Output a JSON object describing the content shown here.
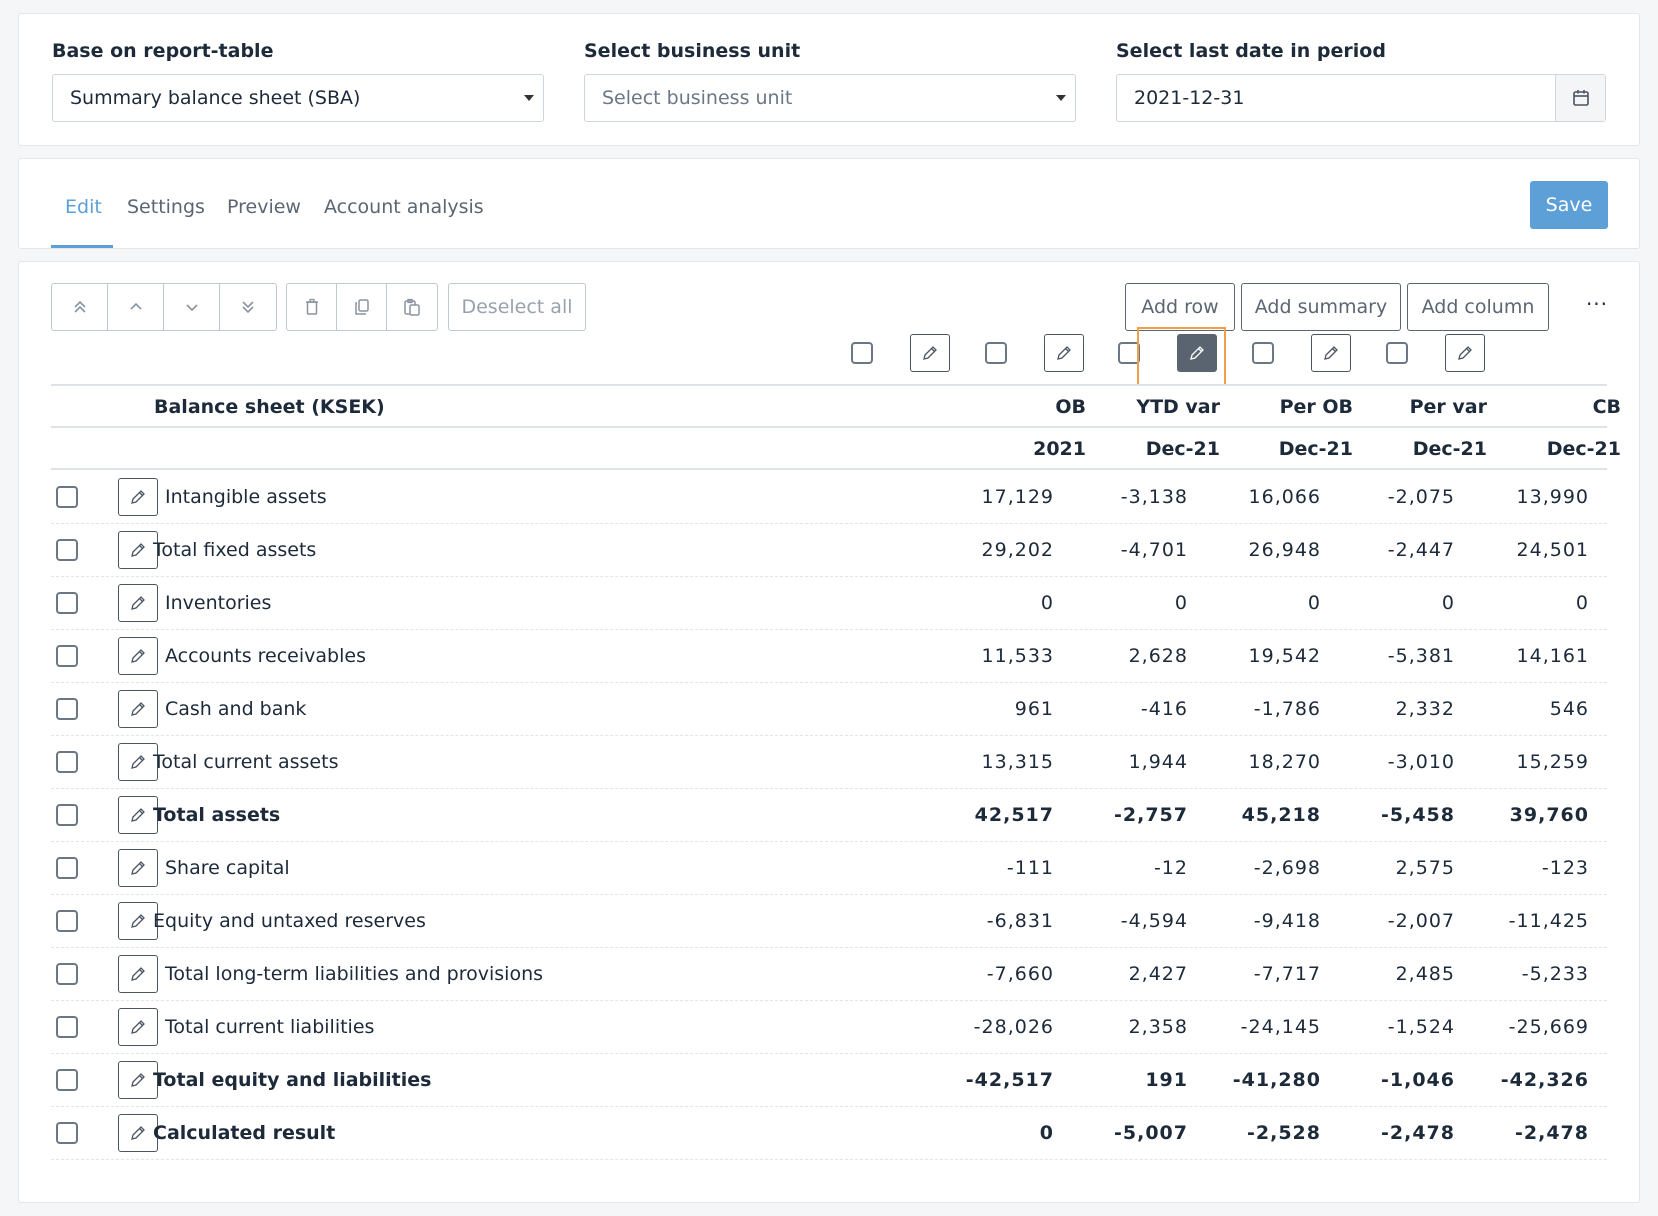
{
  "filters": {
    "report_table": {
      "label": "Base on report-table",
      "value": "Summary balance sheet (SBA)"
    },
    "business_unit": {
      "label": "Select business unit",
      "placeholder": "Select business unit"
    },
    "last_date": {
      "label": "Select last date in period",
      "value": "2021-12-31"
    }
  },
  "tabs": [
    {
      "label": "Edit",
      "active": true
    },
    {
      "label": "Settings",
      "active": false
    },
    {
      "label": "Preview",
      "active": false
    },
    {
      "label": "Account analysis",
      "active": false
    }
  ],
  "save_label": "Save",
  "toolbar": {
    "move_icons": [
      "double-chevron-up-icon",
      "chevron-up-icon",
      "chevron-down-icon",
      "double-chevron-down-icon"
    ],
    "edit_icons": [
      "trash-icon",
      "copy-icon",
      "paste-icon"
    ],
    "deselect_label": "Deselect all",
    "add_row": "Add row",
    "add_summary": "Add summary",
    "add_column": "Add column",
    "more": "···"
  },
  "table": {
    "title": "Balance sheet (KSEK)",
    "columns": [
      {
        "name": "OB",
        "period": "2021"
      },
      {
        "name": "YTD var",
        "period": "Dec-21"
      },
      {
        "name": "Per OB",
        "period": "Dec-21"
      },
      {
        "name": "Per var",
        "period": "Dec-21"
      },
      {
        "name": "CB",
        "period": "Dec-21"
      }
    ],
    "rows": [
      {
        "label": "Intangible assets",
        "indent": true,
        "bold": false,
        "values": [
          "17,129",
          "-3,138",
          "16,066",
          "-2,075",
          "13,990"
        ]
      },
      {
        "label": "Total fixed assets",
        "indent": false,
        "bold": false,
        "values": [
          "29,202",
          "-4,701",
          "26,948",
          "-2,447",
          "24,501"
        ]
      },
      {
        "label": "Inventories",
        "indent": true,
        "bold": false,
        "values": [
          "0",
          "0",
          "0",
          "0",
          "0"
        ]
      },
      {
        "label": "Accounts receivables",
        "indent": true,
        "bold": false,
        "values": [
          "11,533",
          "2,628",
          "19,542",
          "-5,381",
          "14,161"
        ]
      },
      {
        "label": "Cash and bank",
        "indent": true,
        "bold": false,
        "values": [
          "961",
          "-416",
          "-1,786",
          "2,332",
          "546"
        ]
      },
      {
        "label": "Total current assets",
        "indent": false,
        "bold": false,
        "values": [
          "13,315",
          "1,944",
          "18,270",
          "-3,010",
          "15,259"
        ]
      },
      {
        "label": "Total assets",
        "indent": false,
        "bold": true,
        "values": [
          "42,517",
          "-2,757",
          "45,218",
          "-5,458",
          "39,760"
        ]
      },
      {
        "label": "Share capital",
        "indent": true,
        "bold": false,
        "values": [
          "-111",
          "-12",
          "-2,698",
          "2,575",
          "-123"
        ]
      },
      {
        "label": "Equity and untaxed reserves",
        "indent": false,
        "bold": false,
        "values": [
          "-6,831",
          "-4,594",
          "-9,418",
          "-2,007",
          "-11,425"
        ]
      },
      {
        "label": "Total long-term liabilities and provisions",
        "indent": true,
        "bold": false,
        "values": [
          "-7,660",
          "2,427",
          "-7,717",
          "2,485",
          "-5,233"
        ]
      },
      {
        "label": "Total current liabilities",
        "indent": true,
        "bold": false,
        "values": [
          "-28,026",
          "2,358",
          "-24,145",
          "-1,524",
          "-25,669"
        ]
      },
      {
        "label": "Total equity and liabilities",
        "indent": false,
        "bold": true,
        "values": [
          "-42,517",
          "191",
          "-41,280",
          "-1,046",
          "-42,326"
        ]
      },
      {
        "label": "Calculated result",
        "indent": false,
        "bold": true,
        "values": [
          "0",
          "-5,007",
          "-2,528",
          "-2,478",
          "-2,478"
        ]
      }
    ]
  },
  "colors": {
    "accent": "#5da0d8",
    "highlight": "#f0a04b",
    "dark_button": "#5a6470"
  }
}
